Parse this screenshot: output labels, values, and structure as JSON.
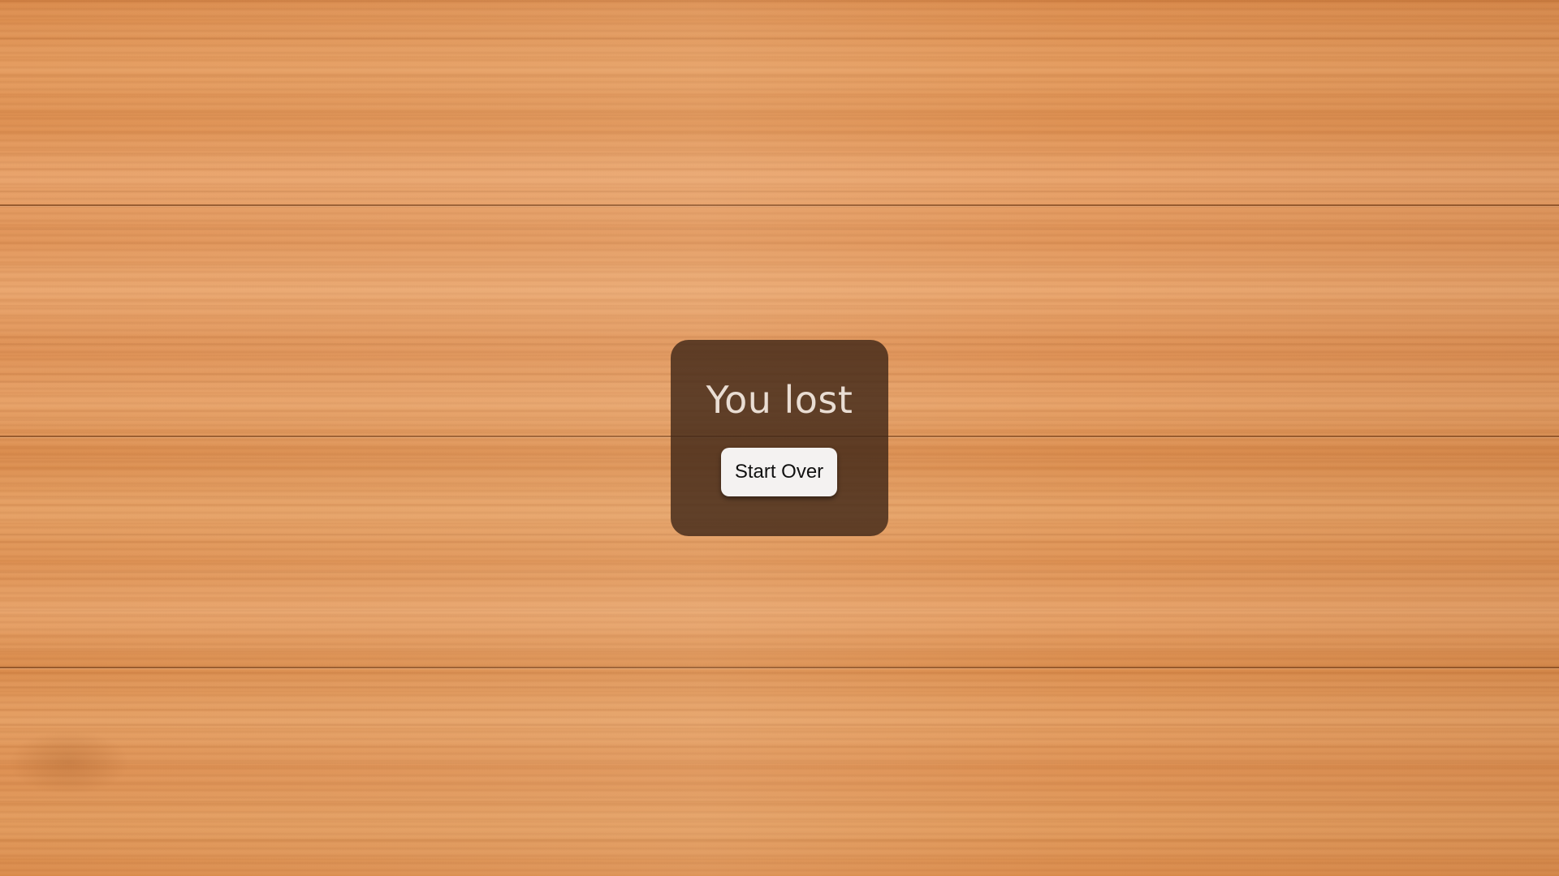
{
  "dialog": {
    "title": "You lost",
    "start_over_label": "Start Over"
  },
  "colors": {
    "board_wood": "#e09a5e",
    "dialog_background": "#3a2314",
    "title_text": "#e9ddd3",
    "button_background": "#f4f2f1",
    "button_text": "#111111"
  }
}
